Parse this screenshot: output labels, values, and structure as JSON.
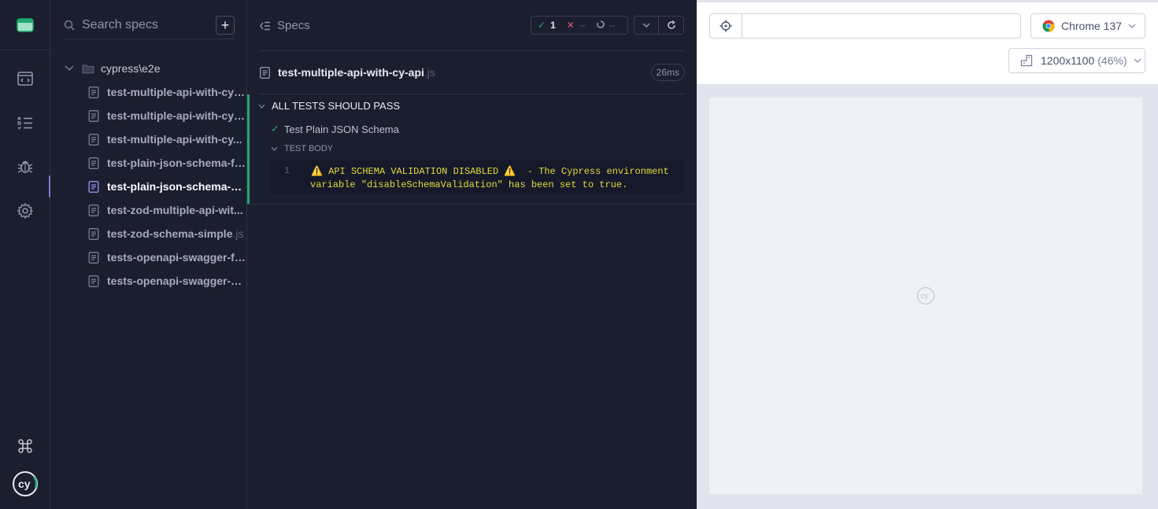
{
  "search": {
    "placeholder": "Search specs"
  },
  "folder": {
    "name": "cypress\\e2e"
  },
  "spec_items": [
    {
      "label": "test-multiple-api-with-cy-...",
      "ext": ""
    },
    {
      "label": "test-multiple-api-with-cy-...",
      "ext": ""
    },
    {
      "label": "test-multiple-api-with-cy...",
      "ext": ""
    },
    {
      "label": "test-plain-json-schema-fa...",
      "ext": ""
    },
    {
      "label": "test-plain-json-schema-p...",
      "ext": ""
    },
    {
      "label": "test-zod-multiple-api-wit...",
      "ext": ""
    },
    {
      "label": "test-zod-schema-simple",
      "ext": ".js"
    },
    {
      "label": "tests-openapi-swagger-fa...",
      "ext": ""
    },
    {
      "label": "tests-openapi-swagger-p...",
      "ext": ""
    }
  ],
  "reporter": {
    "specs_label": "Specs",
    "passed": "1",
    "failed": "--",
    "pending": "--",
    "file_name": "test-multiple-api-with-cy-api",
    "file_ext": ".js",
    "duration": "26ms",
    "suite_title": "ALL TESTS SHOULD PASS",
    "test_title": "Test Plain JSON Schema",
    "body_label": "TEST BODY",
    "log_line_num": "1",
    "log_line1": "⚠️ API SCHEMA VALIDATION DISABLED ⚠️  - The Cypress environment",
    "log_line2": "variable \"disableSchemaValidation\" has been set to true."
  },
  "preview": {
    "browser": "Chrome 137",
    "viewport": "1200x1100",
    "zoom": "(46%)"
  },
  "colors": {
    "accent": "#7c7fd8",
    "pass": "#1fa971",
    "fail": "#e45770",
    "log_text": "#e6db3a"
  }
}
